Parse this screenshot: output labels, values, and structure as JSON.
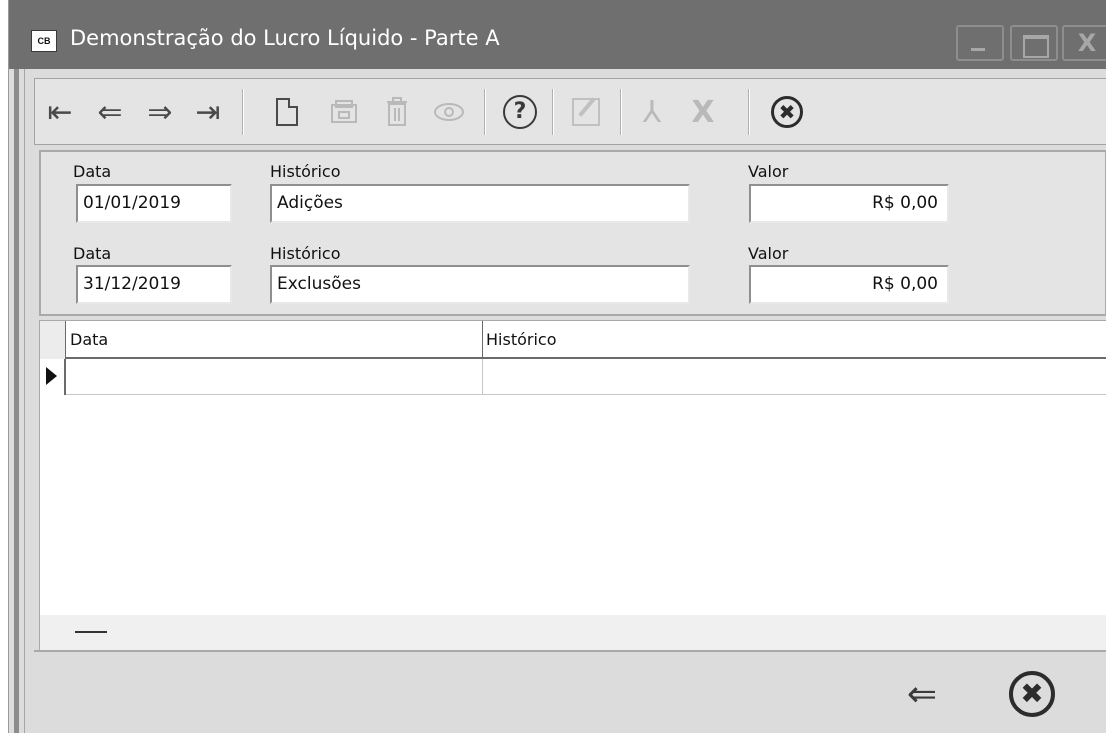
{
  "window": {
    "app_icon_text": "CB",
    "title": "Demonstração do Lucro Líquido - Parte A",
    "close_glyph": "X"
  },
  "toolbar": {
    "first_glyph": "⇤",
    "prev_glyph": "⇐",
    "next_glyph": "⇒",
    "last_glyph": "⇥",
    "help_glyph": "?",
    "pdf_glyph": "⅄",
    "excel_glyph": "X",
    "cancel_glyph": "✖"
  },
  "form": {
    "row1": {
      "data_label": "Data",
      "data_value": "01/01/2019",
      "historico_label": "Histórico",
      "historico_value": "Adições",
      "valor_label": "Valor",
      "valor_value": "R$ 0,00"
    },
    "row2": {
      "data_label": "Data",
      "data_value": "31/12/2019",
      "historico_label": "Histórico",
      "historico_value": "Exclusões",
      "valor_label": "Valor",
      "valor_value": "R$ 0,00"
    }
  },
  "grid": {
    "columns": [
      "Data",
      "Histórico"
    ],
    "rows": [
      {
        "data": "",
        "historico": ""
      }
    ]
  },
  "bottom": {
    "back_glyph": "⇐",
    "exit_glyph": "✖"
  }
}
